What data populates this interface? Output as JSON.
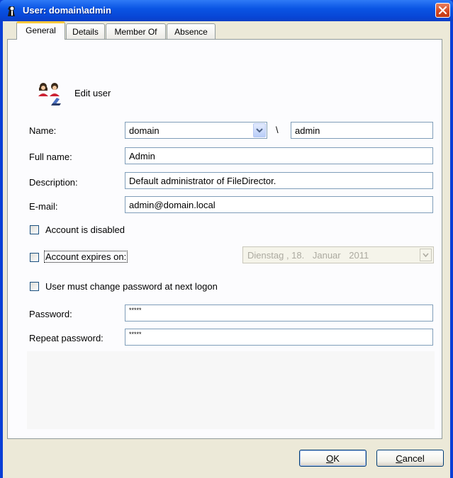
{
  "window": {
    "title": "User: domain\\admin",
    "app_icon": "user-icon",
    "close_icon": "close-icon"
  },
  "tabs": [
    {
      "label": "General",
      "active": true
    },
    {
      "label": "Details",
      "active": false
    },
    {
      "label": "Member Of",
      "active": false
    },
    {
      "label": "Absence",
      "active": false
    }
  ],
  "header": {
    "icon": "users-edit-icon",
    "label": "Edit user"
  },
  "form": {
    "name_label": "Name:",
    "domain_value": "domain",
    "separator": "\\",
    "username_value": "admin",
    "fullname_label": "Full name:",
    "fullname_value": "Admin",
    "description_label": "Description:",
    "description_value": "Default administrator of FileDirector.",
    "email_label": "E-mail:",
    "email_value": "admin@domain.local",
    "account_disabled_label": "Account is disabled",
    "account_disabled_checked": false,
    "account_expires_label": "Account expires on:",
    "account_expires_checked": false,
    "expires_weekday": "Dienstag",
    "expires_day": ", 18.",
    "expires_month": "Januar",
    "expires_year": "2011",
    "must_change_label": "User must change password at next logon",
    "must_change_checked": false,
    "password_label": "Password:",
    "password_value": "*****",
    "repeat_label": "Repeat password:",
    "repeat_value": "*****"
  },
  "buttons": {
    "ok_underlined": "O",
    "ok_rest": "K",
    "cancel_underlined": "C",
    "cancel_rest": "ancel"
  },
  "colors": {
    "titlebar": "#0a55e4",
    "close": "#d3461f",
    "tab_highlight": "#ffc83c"
  }
}
